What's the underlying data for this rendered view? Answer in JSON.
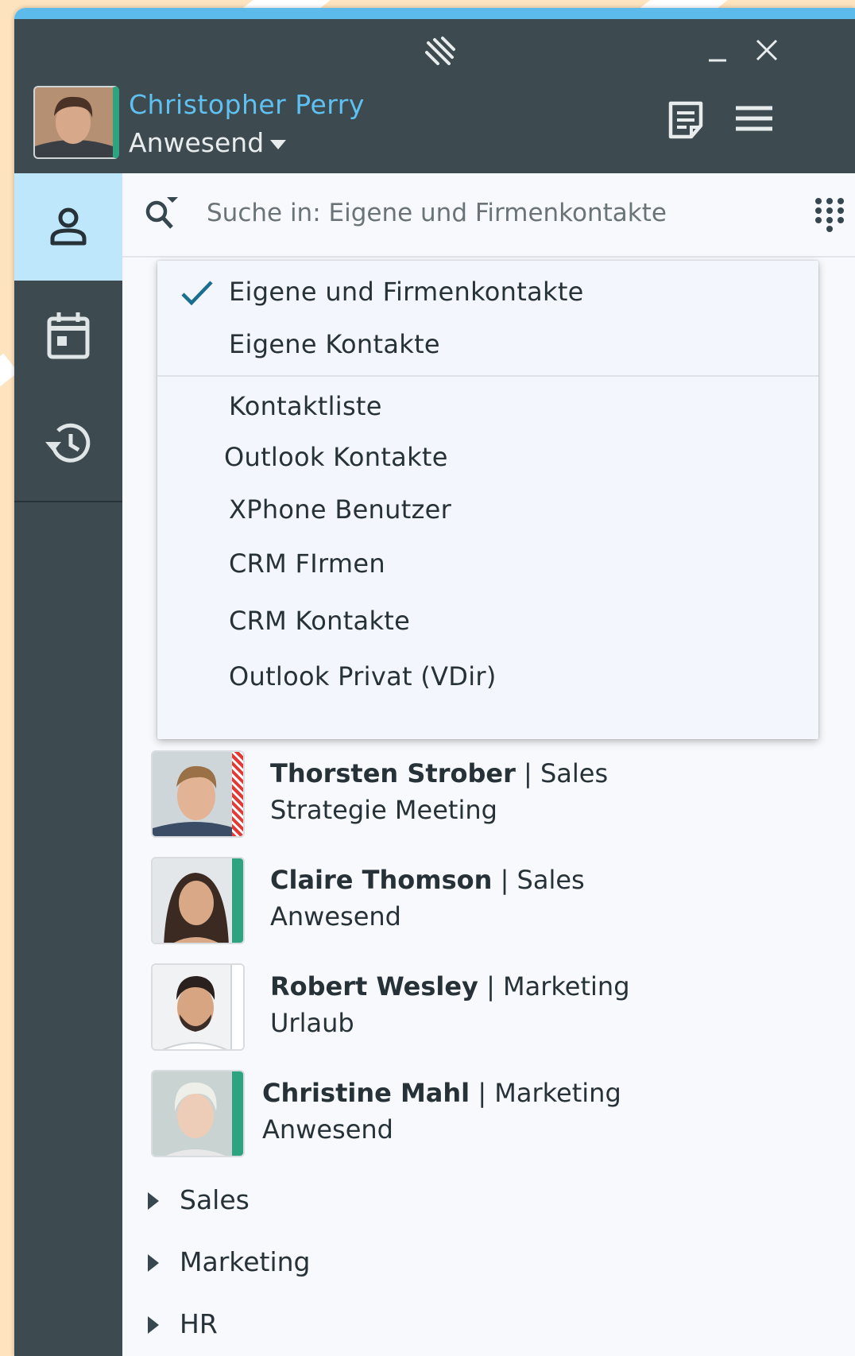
{
  "user": {
    "name": "Christopher Perry",
    "status": "Anwesend"
  },
  "search": {
    "placeholder": "Suche in: Eigene und Firmenkontakte"
  },
  "dropdown": {
    "selected": "Eigene und Firmenkontakte",
    "items": [
      {
        "label": "Eigene und Firmenkontakte",
        "checked": true
      },
      {
        "label": "Eigene Kontakte",
        "checked": false
      },
      {
        "label": "Kontaktliste",
        "checked": false
      },
      {
        "label": "Outlook Kontakte",
        "checked": false
      },
      {
        "label": "XPhone Benutzer",
        "checked": false
      },
      {
        "label": "CRM FIrmen",
        "checked": false
      },
      {
        "label": "CRM Kontakte",
        "checked": false
      },
      {
        "label": "Outlook Privat (VDir)",
        "checked": false
      }
    ]
  },
  "contacts": [
    {
      "name": "Thorsten Strober",
      "dept": "Sales",
      "status": "Strategie Meeting",
      "status_color": "#e53935"
    },
    {
      "name": "Claire Thomson",
      "dept": "Sales",
      "status": "Anwesend",
      "status_color": "#2ea380"
    },
    {
      "name": "Robert Wesley",
      "dept": "Marketing",
      "status": "Urlaub",
      "status_color": "#ffffff"
    },
    {
      "name": "Christine Mahl",
      "dept": "Marketing",
      "status": "Anwesend",
      "status_color": "#2ea380"
    }
  ],
  "groups": [
    {
      "label": "Sales"
    },
    {
      "label": "Marketing"
    },
    {
      "label": "HR"
    }
  ],
  "colors": {
    "header_bg": "#3d4a4f",
    "accent_blue": "#5dbbec",
    "active_nav": "#bfe7fb",
    "available": "#2ea380",
    "busy": "#e53935"
  },
  "icons": {
    "logo": "app-logo-icon",
    "minimize": "minimize-icon",
    "close": "close-icon",
    "notes": "notes-icon",
    "menu": "hamburger-menu-icon",
    "contacts": "person-icon",
    "calendar": "calendar-icon",
    "history": "history-icon",
    "search": "search-filter-icon",
    "dialpad": "dialpad-icon",
    "check": "check-icon",
    "expand": "caret-right-icon"
  }
}
